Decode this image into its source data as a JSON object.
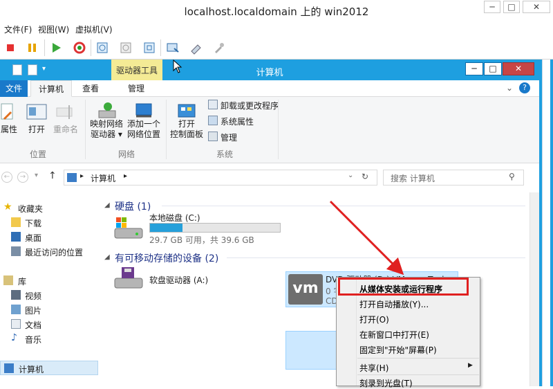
{
  "vm": {
    "title": "localhost.localdomain 上的 win2012",
    "menu": [
      "文件(F)",
      "视图(W)",
      "虚拟机(V)"
    ],
    "toolbar_icons": [
      "stop-icon",
      "pause-icon",
      "play-icon",
      "reset-icon",
      "snapshot-icon",
      "revert-icon",
      "manage-snapshot-icon",
      "console-icon",
      "connect-device-icon",
      "settings-icon"
    ]
  },
  "explorer": {
    "title": "计算机",
    "context_tab": "驱动器工具",
    "tabs": {
      "file": "文件",
      "computer": "计算机",
      "view": "查看",
      "manage": "管理"
    },
    "ribbon": {
      "location": {
        "properties": "属性",
        "open": "打开",
        "rename": "重命名",
        "group": "位置"
      },
      "network": {
        "map_drive_1": "映射网络",
        "map_drive_2": "驱动器 ▾",
        "add_loc_1": "添加一个",
        "add_loc_2": "网络位置",
        "group": "网络"
      },
      "system": {
        "control_panel_1": "打开",
        "control_panel_2": "控制面板",
        "uninstall": "卸载或更改程序",
        "sys_props": "系统属性",
        "manage": "管理",
        "group": "系统"
      }
    },
    "address": {
      "path": "计算机",
      "search_placeholder": "搜索 计算机"
    },
    "nav": {
      "favorites": "收藏夹",
      "downloads": "下载",
      "desktop": "桌面",
      "recent": "最近访问的位置",
      "libraries": "库",
      "videos": "视频",
      "pictures": "图片",
      "documents": "文档",
      "music": "音乐",
      "computer": "计算机"
    },
    "content": {
      "hdd_section": "硬盘 (1)",
      "local_disk": "本地磁盘 (C:)",
      "local_disk_info": "29.7 GB 可用，共 39.6 GB",
      "local_disk_used_fraction": 0.25,
      "removable_section": "有可移动存储的设备 (2)",
      "floppy": "软盘驱动器 (A:)",
      "dvd_name": "DVD 驱动器 (D:) VMware Tools",
      "dvd_line2": "0 字",
      "dvd_line3": "CD"
    },
    "context_menu": {
      "install": "从媒体安装或运行程序",
      "autoplay": "打开自动播放(Y)...",
      "open": "打开(O)",
      "open_new": "在新窗口中打开(E)",
      "pin": "固定到\"开始\"屏幕(P)",
      "share": "共享(H)",
      "burn": "刻录到光盘(T)"
    }
  },
  "colors": {
    "accent": "#1e9fe0",
    "file_tab": "#1979ca",
    "highlight": "#e02020",
    "drive_tools": "#f4eb95"
  }
}
